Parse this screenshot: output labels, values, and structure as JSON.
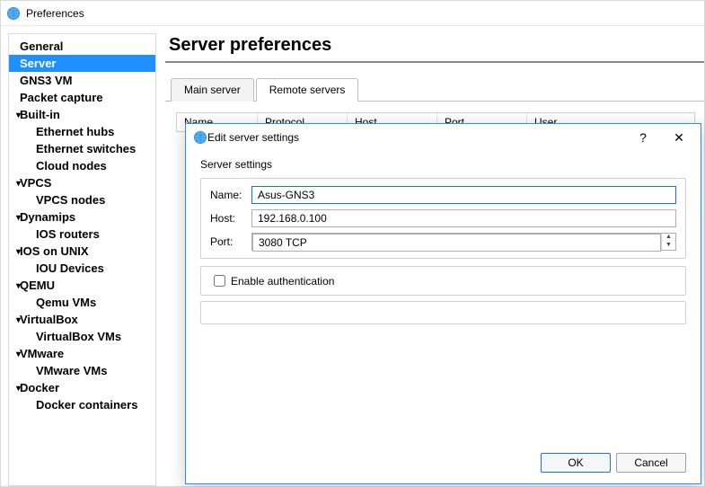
{
  "window": {
    "title": "Preferences"
  },
  "tree": {
    "items": [
      {
        "label": "General",
        "level": 0
      },
      {
        "label": "Server",
        "level": 0,
        "selected": true
      },
      {
        "label": "GNS3 VM",
        "level": 0
      },
      {
        "label": "Packet capture",
        "level": 0
      },
      {
        "label": "Built-in",
        "level": 0,
        "caret": true
      },
      {
        "label": "Ethernet hubs",
        "level": 1
      },
      {
        "label": "Ethernet switches",
        "level": 1
      },
      {
        "label": "Cloud nodes",
        "level": 1
      },
      {
        "label": "VPCS",
        "level": 0,
        "caret": true
      },
      {
        "label": "VPCS nodes",
        "level": 1
      },
      {
        "label": "Dynamips",
        "level": 0,
        "caret": true
      },
      {
        "label": "IOS routers",
        "level": 1
      },
      {
        "label": "IOS on UNIX",
        "level": 0,
        "caret": true
      },
      {
        "label": "IOU Devices",
        "level": 1
      },
      {
        "label": "QEMU",
        "level": 0,
        "caret": true
      },
      {
        "label": "Qemu VMs",
        "level": 1
      },
      {
        "label": "VirtualBox",
        "level": 0,
        "caret": true
      },
      {
        "label": "VirtualBox VMs",
        "level": 1
      },
      {
        "label": "VMware",
        "level": 0,
        "caret": true
      },
      {
        "label": "VMware VMs",
        "level": 1
      },
      {
        "label": "Docker",
        "level": 0,
        "caret": true
      },
      {
        "label": "Docker containers",
        "level": 1
      }
    ]
  },
  "main": {
    "heading": "Server preferences",
    "tabs": {
      "main_server": "Main server",
      "remote_servers": "Remote servers"
    },
    "table": {
      "columns": {
        "name": "Name",
        "protocol": "Protocol",
        "host": "Host",
        "port": "Port",
        "user": "User"
      }
    }
  },
  "dialog": {
    "title": "Edit server settings",
    "section_label": "Server settings",
    "labels": {
      "name": "Name:",
      "host": "Host:",
      "port": "Port:"
    },
    "values": {
      "name": "Asus-GNS3",
      "host": "192.168.0.100",
      "port": "3080 TCP"
    },
    "auth_label": "Enable authentication",
    "auth_checked": false,
    "buttons": {
      "ok": "OK",
      "cancel": "Cancel"
    },
    "titlebar": {
      "help": "?",
      "close": "✕"
    }
  }
}
